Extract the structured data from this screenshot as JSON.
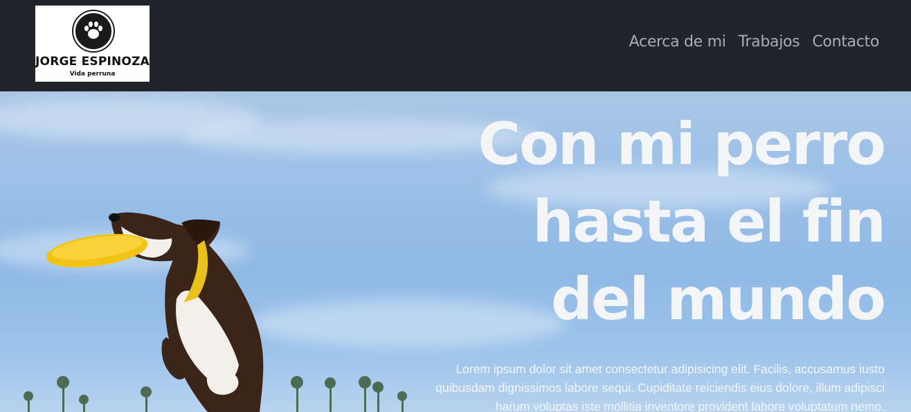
{
  "header": {
    "logo": {
      "brand": "JORGE ESPINOZA",
      "tagline": "Vida perruna",
      "icon": "paw-icon"
    },
    "nav": [
      {
        "label": "Acerca de mi"
      },
      {
        "label": "Trabajos"
      },
      {
        "label": "Contacto"
      }
    ]
  },
  "hero": {
    "title_lines": [
      "Con mi perro",
      "hasta el fin",
      "del mundo"
    ],
    "text": "Lorem ipsum dolor sit amet consectetur adipisicing elit. Facilis, accusamus iusto quibusdam dignissimos labore sequi. Cupiditate reiciendis eius dolore, illum adipisci harum voluptas iste mollitia inventore provident labore voluptatum nemo.",
    "image": "dog-catching-frisbee-photo"
  },
  "colors": {
    "navbar_bg": "#212529",
    "nav_link": "#a9adb1",
    "hero_text": "#f4f5f7",
    "frisbee": "#f2c315"
  }
}
